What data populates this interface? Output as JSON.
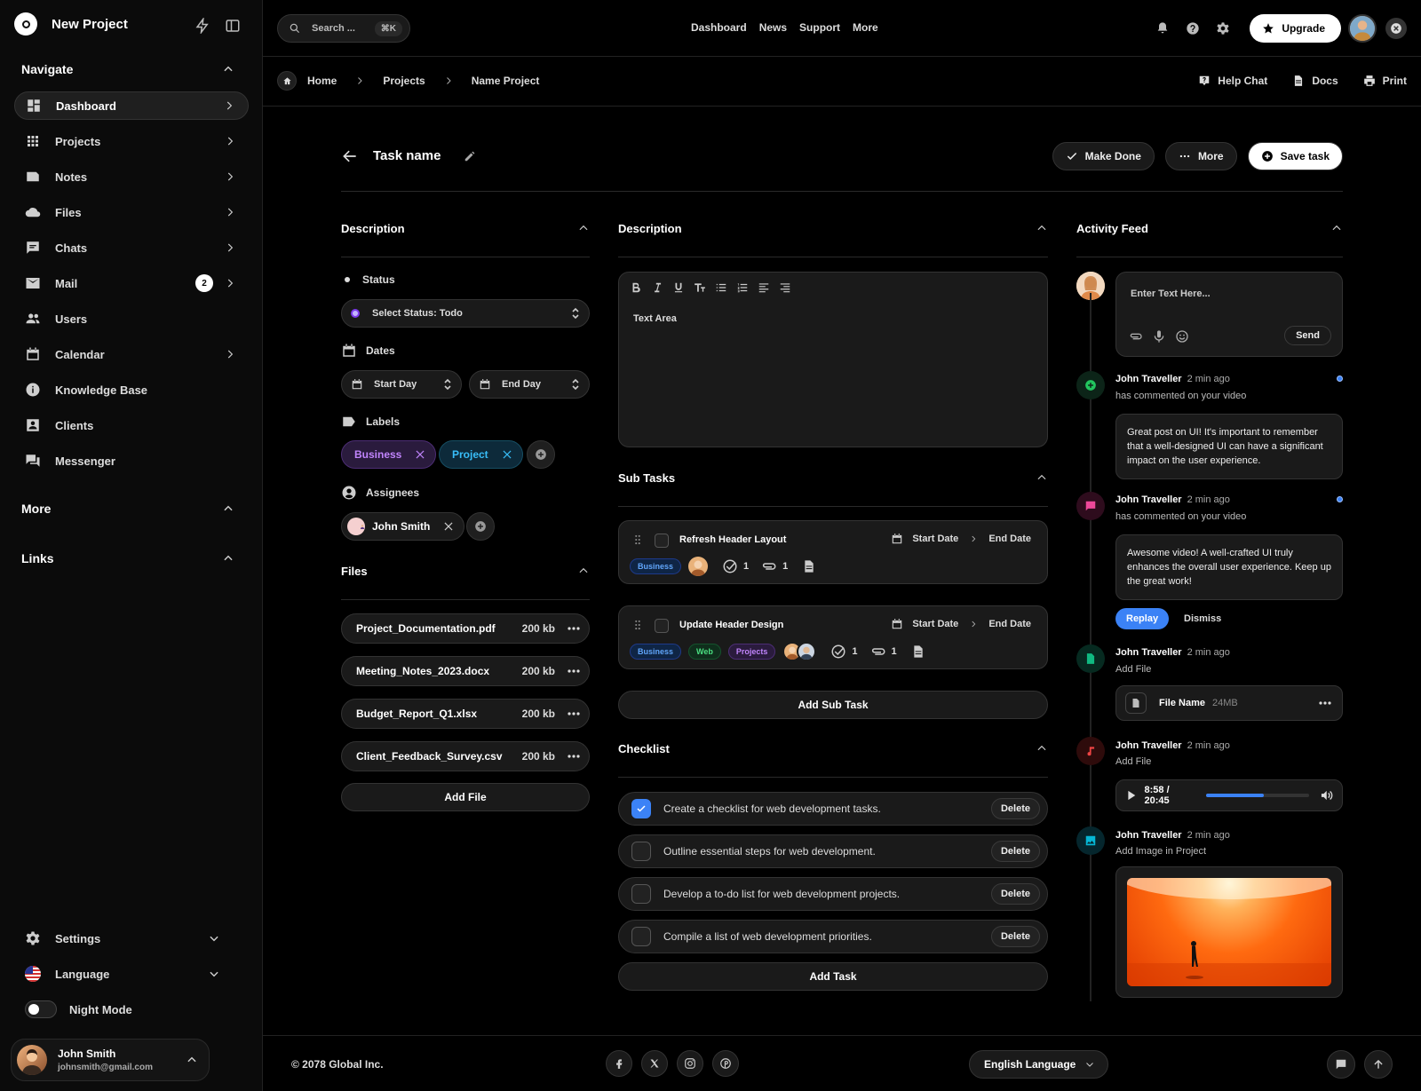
{
  "app": {
    "title": "New Project"
  },
  "sidebar": {
    "navigate_heading": "Navigate",
    "items": [
      {
        "label": "Dashboard",
        "icon": "dashboard-icon"
      },
      {
        "label": "Projects",
        "icon": "grid-icon"
      },
      {
        "label": "Notes",
        "icon": "note-icon"
      },
      {
        "label": "Files",
        "icon": "cloud-icon"
      },
      {
        "label": "Chats",
        "icon": "chat-icon"
      },
      {
        "label": "Mail",
        "icon": "mail-icon",
        "badge": "2"
      },
      {
        "label": "Users",
        "icon": "users-icon"
      },
      {
        "label": "Calendar",
        "icon": "calendar-icon"
      },
      {
        "label": "Knowledge Base",
        "icon": "info-icon"
      },
      {
        "label": "Clients",
        "icon": "contact-icon"
      },
      {
        "label": "Messenger",
        "icon": "forum-icon"
      }
    ],
    "more_heading": "More",
    "links_heading": "Links",
    "settings_label": "Settings",
    "language_label": "Language",
    "night_mode_label": "Night Mode",
    "user": {
      "name": "John Smith",
      "email": "johnsmith@gmail.com"
    }
  },
  "topbar": {
    "search_placeholder": "Search ...",
    "search_shortcut": "⌘K",
    "nav": [
      "Dashboard",
      "News",
      "Support",
      "More"
    ],
    "upgrade_label": "Upgrade"
  },
  "breadcrumb": {
    "items": [
      "Home",
      "Projects",
      "Name Project"
    ],
    "actions": {
      "help": "Help Chat",
      "docs": "Docs",
      "print": "Print"
    }
  },
  "task": {
    "name": "Task name",
    "make_done": "Make Done",
    "more": "More",
    "save": "Save task"
  },
  "left": {
    "description_heading": "Description",
    "status_label": "Status",
    "status_value": "Select Status: Todo",
    "dates_label": "Dates",
    "start_day": "Start Day",
    "end_day": "End Day",
    "labels_label": "Labels",
    "labels": [
      {
        "text": "Business",
        "color": "#c084fc"
      },
      {
        "text": "Project",
        "color": "#38bdf8"
      }
    ],
    "assignees_label": "Assignees",
    "assignee": "John Smith",
    "files_heading": "Files",
    "files": [
      {
        "name": "Project_Documentation.pdf",
        "size": "200 kb"
      },
      {
        "name": "Meeting_Notes_2023.docx",
        "size": "200 kb"
      },
      {
        "name": "Budget_Report_Q1.xlsx",
        "size": "200 kb"
      },
      {
        "name": "Client_Feedback_Survey.csv",
        "size": "200 kb"
      }
    ],
    "add_file": "Add File"
  },
  "middle": {
    "description_heading": "Description",
    "editor_placeholder": "Text Area",
    "subtasks_heading": "Sub Tasks",
    "subtasks": [
      {
        "title": "Refresh Header Layout",
        "start": "Start Date",
        "end": "End Date",
        "tags": [
          "Business"
        ],
        "checks": "1",
        "attachments": "1"
      },
      {
        "title": "Update Header Design",
        "start": "Start Date",
        "end": "End Date",
        "tags": [
          "Business",
          "Web",
          "Projects"
        ],
        "checks": "1",
        "attachments": "1"
      }
    ],
    "add_subtask": "Add Sub Task",
    "checklist_heading": "Checklist",
    "checklist": [
      {
        "text": "Create a checklist for web development tasks.",
        "checked": true
      },
      {
        "text": "Outline essential steps for web development.",
        "checked": false
      },
      {
        "text": "Develop a to-do list for web development projects.",
        "checked": false
      },
      {
        "text": "Compile a list of web development priorities.",
        "checked": false
      }
    ],
    "delete_label": "Delete",
    "add_task": "Add Task"
  },
  "activity": {
    "heading": "Activity Feed",
    "composer_placeholder": "Enter Text Here...",
    "send": "Send",
    "entries": [
      {
        "name": "John Traveller",
        "time": "2 min ago",
        "action": "has commented on your video",
        "body": "Great post on UI! It's important to remember that a well-designed UI can have a significant impact on the user experience.",
        "color": "#22c55e"
      },
      {
        "name": "John Traveller",
        "time": "2 min ago",
        "action": "has commented on your video",
        "body": "Awesome video! A well-crafted UI truly enhances the overall user experience. Keep up the great work!",
        "color": "#ec4899"
      },
      {
        "name": "John Traveller",
        "time": "2 min ago",
        "action": "Add File",
        "color": "#10b981"
      },
      {
        "name": "John Traveller",
        "time": "2 min ago",
        "action": "Add File",
        "color": "#ef4444"
      },
      {
        "name": "John Traveller",
        "time": "2 min ago",
        "action": "Add Image in Project",
        "color": "#06b6d4"
      }
    ],
    "replay": "Replay",
    "dismiss": "Dismiss",
    "file_name": "File Name",
    "file_size": "24MB",
    "audio_time": "8:58 / 20:45",
    "audio_progress": 0.56
  },
  "footer": {
    "copyright": "© 2078 Global Inc.",
    "language": "English Language"
  }
}
